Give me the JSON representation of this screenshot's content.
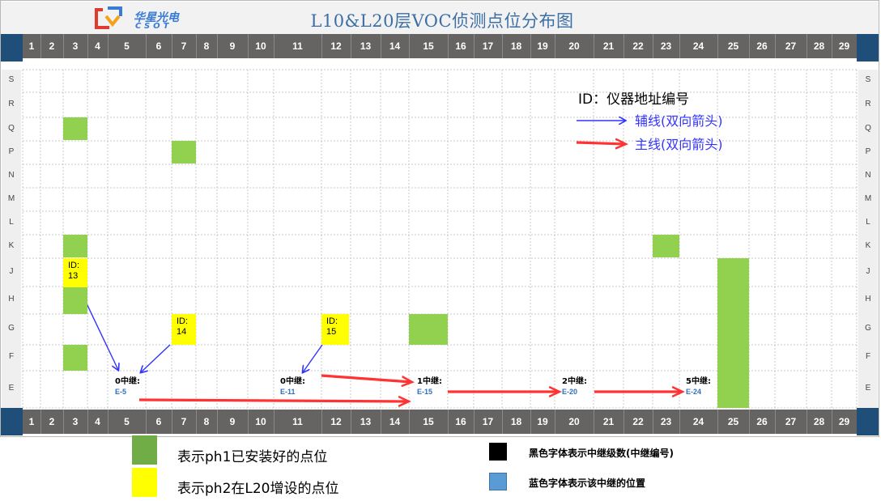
{
  "title": "L10&L20层VOC侦测点位分布图",
  "logo": {
    "cn": "华星光电",
    "en": "CSOT"
  },
  "columns": [
    "1",
    "2",
    "3",
    "4",
    "5",
    "6",
    "7",
    "8",
    "9",
    "10",
    "11",
    "12",
    "13",
    "14",
    "15",
    "16",
    "17",
    "18",
    "19",
    "20",
    "21",
    "22",
    "23",
    "24",
    "25",
    "26",
    "27",
    "28",
    "29"
  ],
  "rows": [
    "S",
    "R",
    "Q",
    "P",
    "N",
    "M",
    "L",
    "K",
    "J",
    "H",
    "G",
    "F",
    "E"
  ],
  "legend": {
    "id_note": "ID：仪器地址编号",
    "aux_line": "辅线(双向箭头)",
    "main_line": "主线(双向箭头)"
  },
  "sensors_ph2": [
    {
      "label": "ID:",
      "id": "13"
    },
    {
      "label": "ID:",
      "id": "14"
    },
    {
      "label": "ID:",
      "id": "15"
    }
  ],
  "relays": [
    {
      "level": "0中继:",
      "position": "E-5"
    },
    {
      "level": "0中继:",
      "position": "E-11"
    },
    {
      "level": "1中继:",
      "position": "E-15"
    },
    {
      "level": "2中继:",
      "position": "E-20"
    },
    {
      "level": "5中继:",
      "position": "E-24"
    }
  ],
  "key": {
    "ph1": "表示ph1已安装好的点位",
    "ph2": "表示ph2在L20增设的点位",
    "black_font": "黑色字体表示中继级数(中继编号)",
    "blue_font": "蓝色字体表示该中继的位置"
  },
  "colors": {
    "ph1_green": "#92d050",
    "ph2_yellow": "#ffff00",
    "aux_line": "#3333ff",
    "main_line": "#ff3333",
    "header_bar": "#666363",
    "corner_blue": "#1f4e79"
  }
}
